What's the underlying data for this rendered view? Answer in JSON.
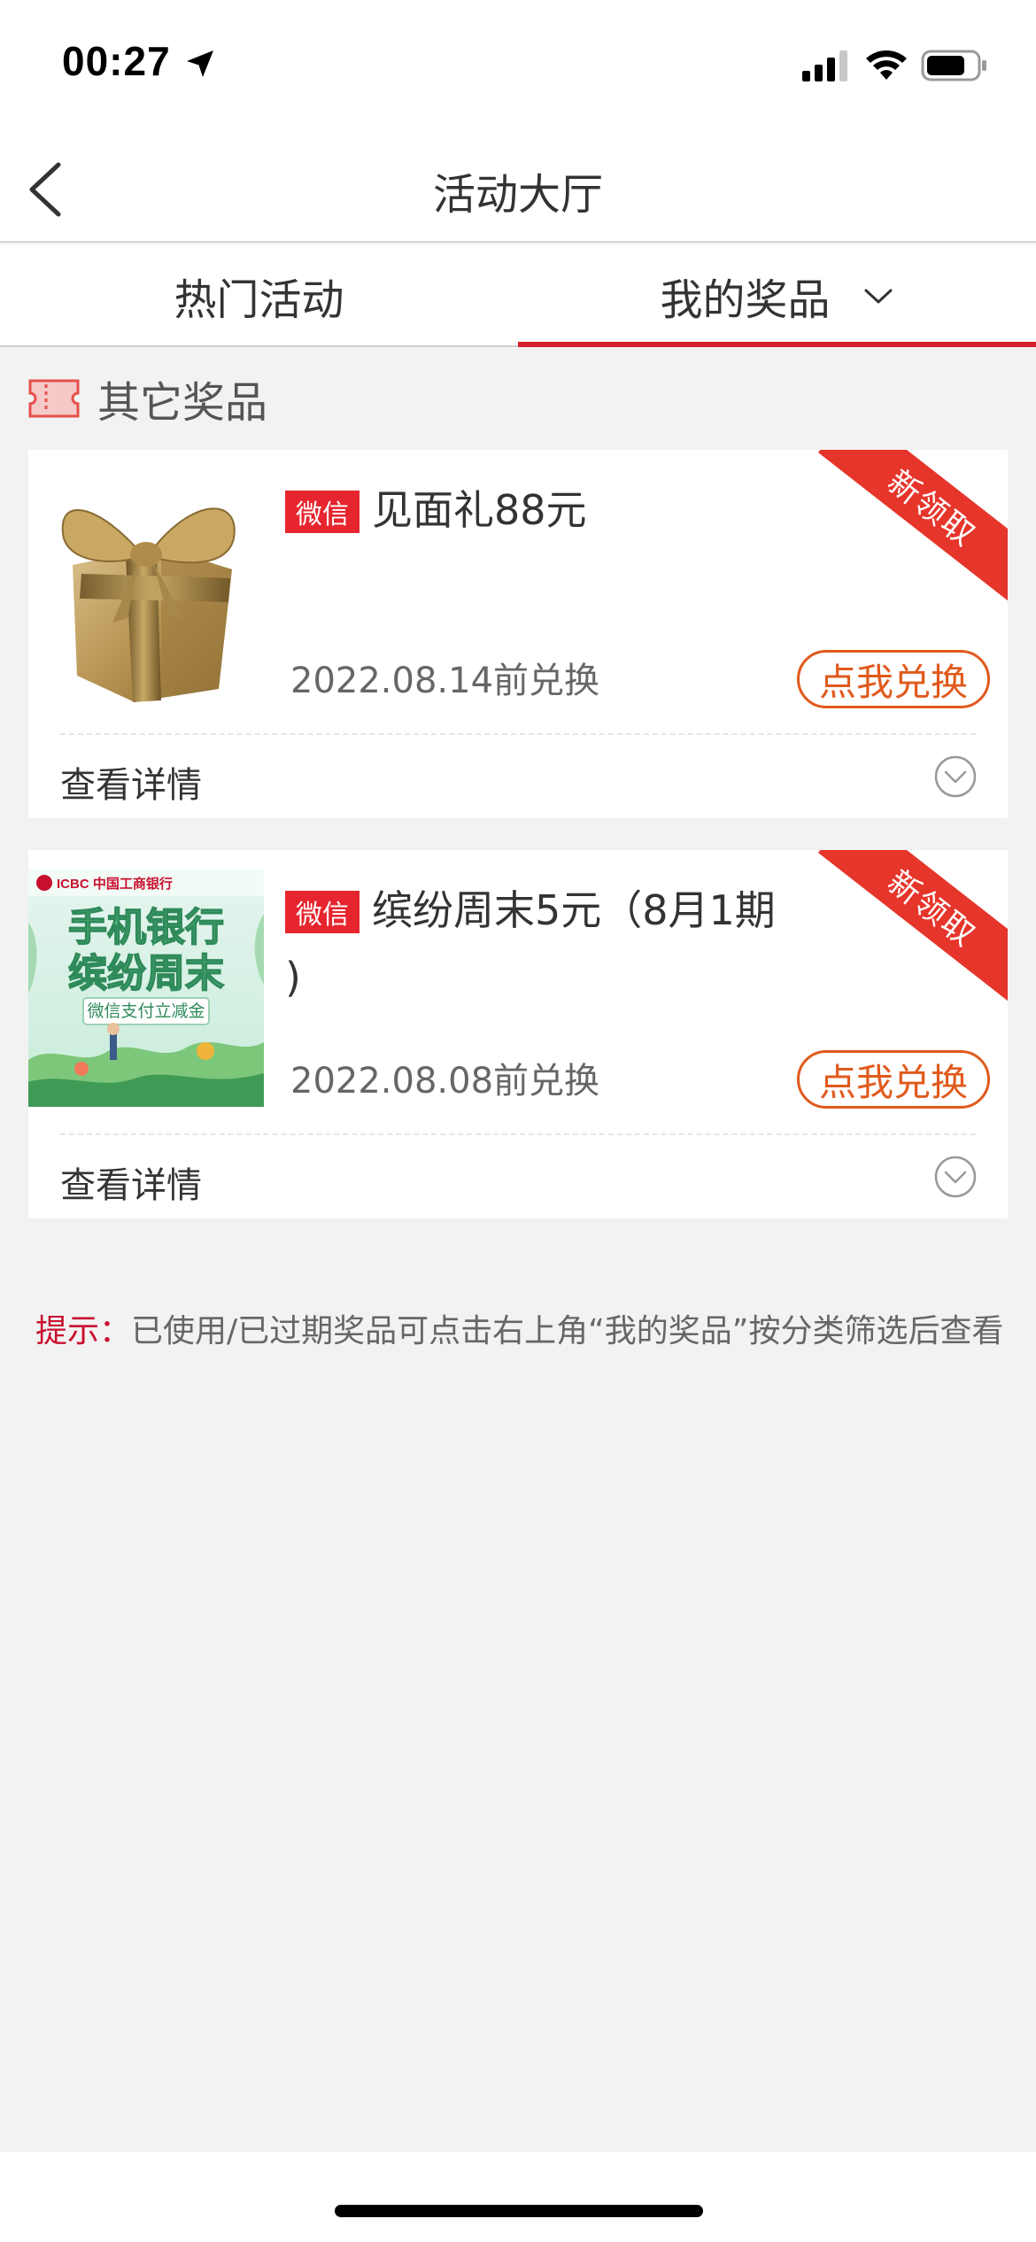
{
  "status_bar": {
    "time": "00:27"
  },
  "nav": {
    "title": "活动大厅"
  },
  "tabs": {
    "hot": "热门活动",
    "mine": "我的奖品"
  },
  "section": {
    "title": "其它奖品"
  },
  "prizes": [
    {
      "channel": "微信",
      "title": "见面礼88元",
      "title_cont": "",
      "deadline": "2022.08.14前兑换",
      "redeem_label": "点我兑换",
      "details_label": "查看详情",
      "ribbon": "新领取"
    },
    {
      "channel": "微信",
      "title": "缤纷周末5元（8月1期",
      "title_cont": ")",
      "deadline": "2022.08.08前兑换",
      "redeem_label": "点我兑换",
      "details_label": "查看详情",
      "ribbon": "新领取",
      "poster": {
        "brand": "ICBC 中国工商银行",
        "line1": "手机银行",
        "line2": "缤纷周末",
        "line3": "微信支付立减金"
      }
    }
  ],
  "tip": {
    "label": "提示：",
    "text": "已使用/已过期奖品可点击右上角“我的奖品”按分类筛选后查看"
  },
  "colors": {
    "accent_red": "#d71f2b",
    "badge_red": "#e6252e",
    "redeem_orange": "#e05a1d"
  }
}
